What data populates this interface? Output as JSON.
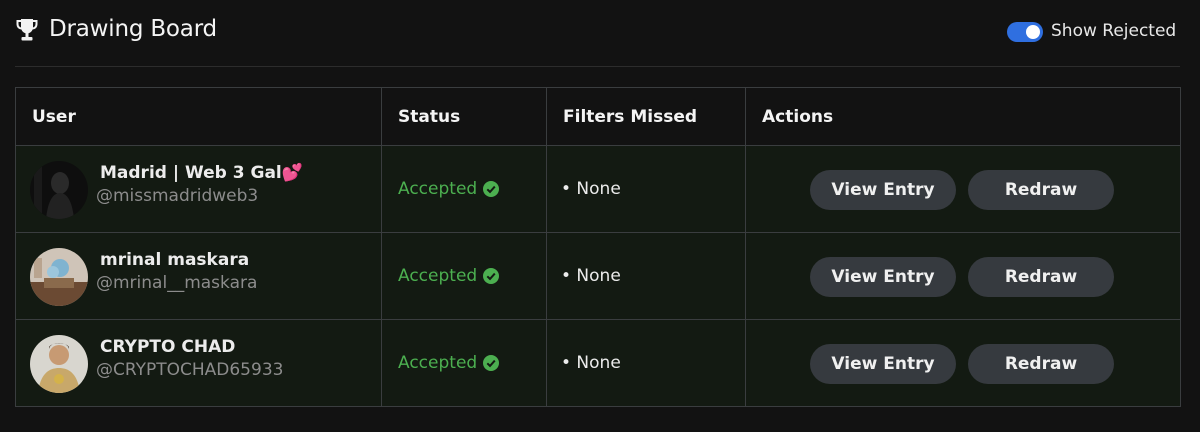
{
  "header": {
    "title": "Drawing Board",
    "icon": "trophy-icon",
    "show_rejected_label": "Show Rejected",
    "show_rejected_on": true
  },
  "table": {
    "columns": [
      "User",
      "Status",
      "Filters Missed",
      "Actions"
    ],
    "rows": [
      {
        "display_name": "Madrid | Web 3 Gal💕",
        "handle": "@missmadridweb3",
        "status": "Accepted",
        "filters_missed": "• None",
        "view_label": "View Entry",
        "redraw_label": "Redraw"
      },
      {
        "display_name": "mrinal maskara",
        "handle": "@mrinal__maskara",
        "status": "Accepted",
        "filters_missed": "• None",
        "view_label": "View Entry",
        "redraw_label": "Redraw"
      },
      {
        "display_name": "CRYPTO CHAD",
        "handle": "@CRYPTOCHAD65933",
        "status": "Accepted",
        "filters_missed": "• None",
        "view_label": "View Entry",
        "redraw_label": "Redraw"
      }
    ]
  },
  "colors": {
    "accent": "#2f6fe0",
    "accepted": "#4caf50",
    "button_bg": "#363a3f",
    "row_bg": "#131a12"
  }
}
